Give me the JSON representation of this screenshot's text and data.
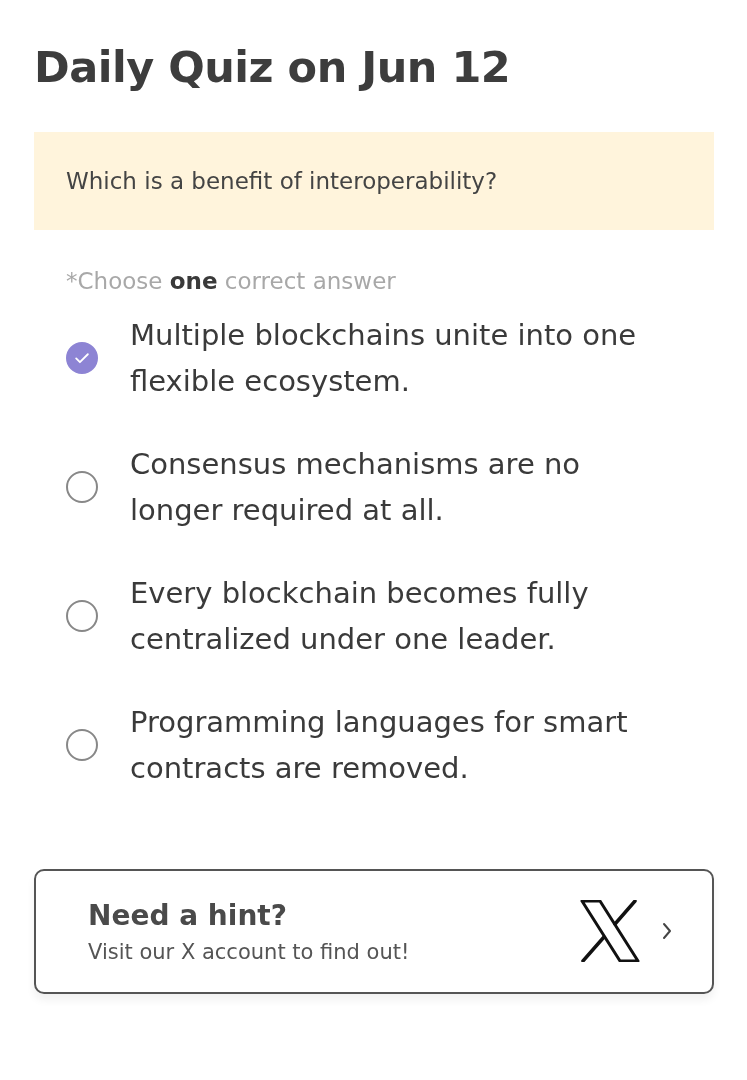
{
  "title": "Daily Quiz on Jun 12",
  "question": "Which is a benefit of interoperability?",
  "instruction": "*Choose **one** correct answer",
  "options": [
    {
      "label": "Multiple blockchains unite into one flexible ecosystem.",
      "selected": true
    },
    {
      "label": "Consensus mechanisms are no longer required at all.",
      "selected": false
    },
    {
      "label": "Every blockchain becomes fully centralized under one leader.",
      "selected": false
    },
    {
      "label": "Programming languages for smart contracts are removed.",
      "selected": false
    }
  ],
  "hint_card": {
    "title": "Need a hint?",
    "subtitle": "Visit our X account to find out!"
  }
}
